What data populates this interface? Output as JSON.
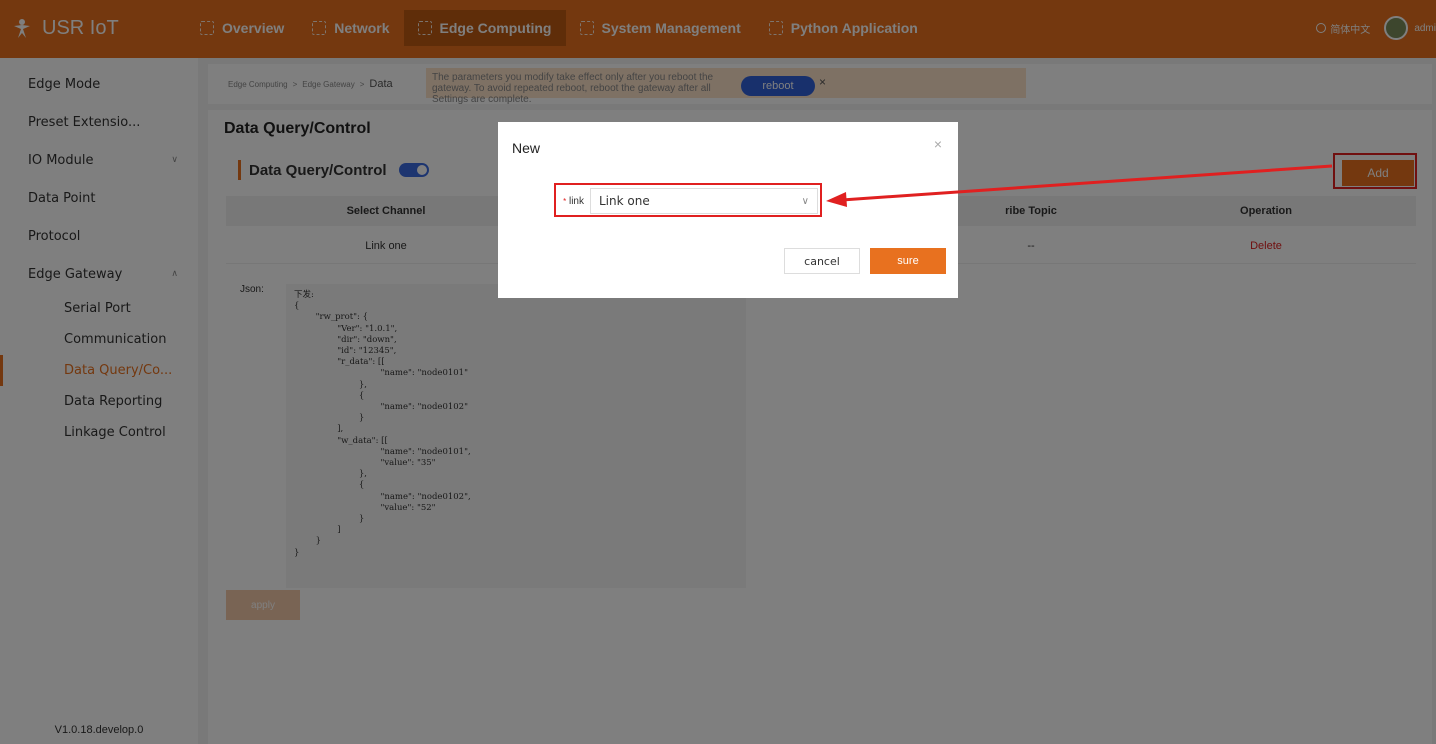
{
  "brand": {
    "name": "USR IoT"
  },
  "nav": {
    "items": [
      {
        "label": "Overview"
      },
      {
        "label": "Network"
      },
      {
        "label": "Edge Computing"
      },
      {
        "label": "System Management"
      },
      {
        "label": "Python Application"
      }
    ],
    "active": "Edge Computing"
  },
  "header": {
    "language": "简体中文",
    "user": "admi"
  },
  "sidebar": {
    "items": [
      {
        "label": "Edge Mode"
      },
      {
        "label": "Preset Extensio..."
      },
      {
        "label": "IO Module"
      },
      {
        "label": "Data Point"
      },
      {
        "label": "Protocol"
      },
      {
        "label": "Edge Gateway"
      }
    ],
    "subitems": [
      {
        "label": "Serial Port"
      },
      {
        "label": "Communication"
      },
      {
        "label": "Data Query/Co..."
      },
      {
        "label": "Data Reporting"
      },
      {
        "label": "Linkage Control"
      }
    ],
    "version": "V1.0.18.develop.0"
  },
  "breadcrumb": {
    "items": [
      "Edge Computing",
      "Edge Gateway",
      "Data"
    ]
  },
  "notice": {
    "text": "The parameters you modify take effect only after you reboot the gateway. To avoid repeated reboot, reboot the gateway after all Settings are complete.",
    "reboot_label": "reboot",
    "close": "×"
  },
  "page": {
    "title": "Data Query/Control",
    "section_title": "Data Query/Control",
    "add_label": "Add"
  },
  "table": {
    "headers": [
      "Select Channel",
      "",
      "ribe Topic",
      "Operation"
    ],
    "rows": [
      {
        "channel": "Link one",
        "topic": "--",
        "operation": "Delete"
      }
    ]
  },
  "json_panel": {
    "label": "Json:",
    "content": "下发:\n{\n        \"rw_prot\": {\n                \"Ver\": \"1.0.1\",\n                \"dir\": \"down\",\n                \"id\": \"12345\",\n                \"r_data\": [[\n                                \"name\": \"node0101\"\n                        },\n                        {\n                                \"name\": \"node0102\"\n                        }\n                ],\n                \"w_data\": [[\n                                \"name\": \"node0101\",\n                                \"value\": \"35\"\n                        },\n                        {\n                                \"name\": \"node0102\",\n                                \"value\": \"52\"\n                        }\n                ]\n        }\n}",
    "apply_label": "apply"
  },
  "modal": {
    "title": "New",
    "close": "×",
    "link_label": "link",
    "link_required": "*",
    "link_value": "Link one",
    "cancel_label": "cancel",
    "sure_label": "sure"
  },
  "colors": {
    "accent": "#e8711f",
    "highlight": "#e02020",
    "toggle": "#3a6ae0"
  }
}
